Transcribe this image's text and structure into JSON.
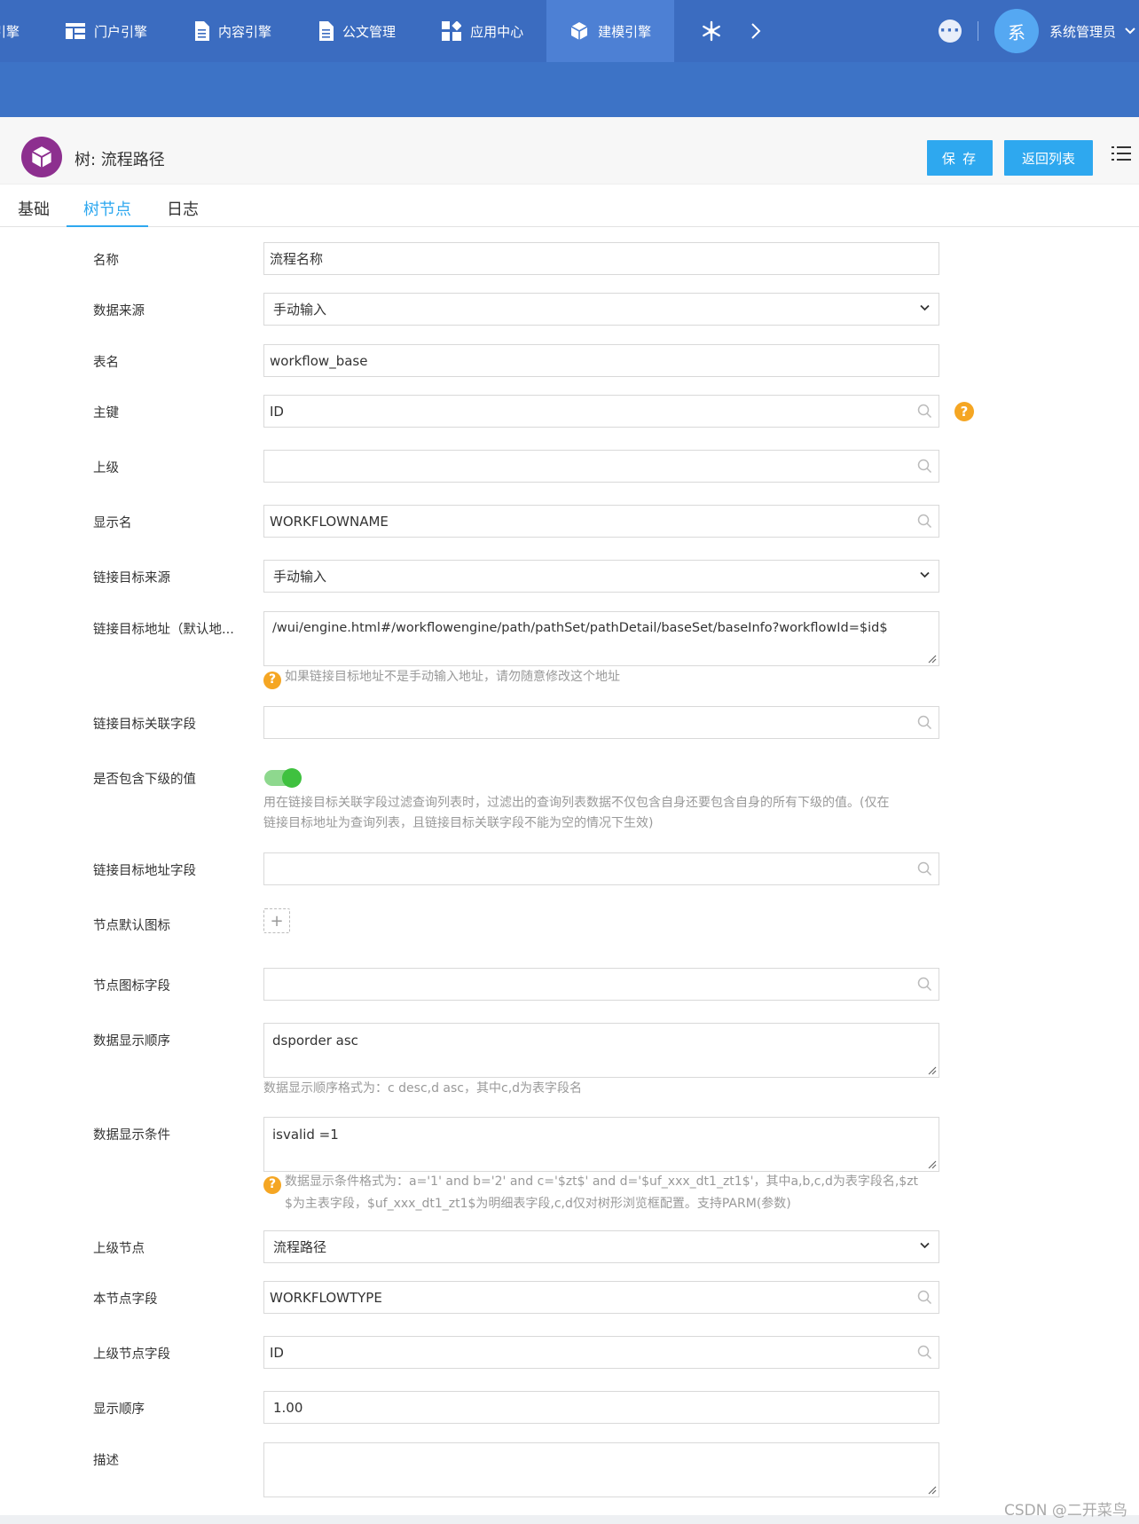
{
  "topnav": {
    "items": [
      {
        "label": "引擎",
        "icon": "none"
      },
      {
        "label": "门户引擎",
        "icon": "portal-layout-icon"
      },
      {
        "label": "内容引擎",
        "icon": "document-icon"
      },
      {
        "label": "公文管理",
        "icon": "document-icon"
      },
      {
        "label": "应用中心",
        "icon": "apps-grid-icon"
      },
      {
        "label": "建模引擎",
        "icon": "cube-icon"
      }
    ],
    "active_index": 5,
    "user_avatar_text": "系",
    "user_name": "系统管理员"
  },
  "header": {
    "title": "树: 流程路径",
    "save_label": "保 存",
    "return_label": "返回列表"
  },
  "tabs": [
    "基础",
    "树节点",
    "日志"
  ],
  "active_tab": 1,
  "form": {
    "name": {
      "label": "名称",
      "value": "流程名称"
    },
    "data_source": {
      "label": "数据来源",
      "value": "手动输入"
    },
    "table_name": {
      "label": "表名",
      "value": "workflow_base"
    },
    "primary_key": {
      "label": "主键",
      "value": "ID"
    },
    "parent": {
      "label": "上级",
      "value": ""
    },
    "display_name": {
      "label": "显示名",
      "value": "WORKFLOWNAME"
    },
    "link_source": {
      "label": "链接目标来源",
      "value": "手动输入"
    },
    "link_url": {
      "label": "链接目标地址（默认地...",
      "value": "/wui/engine.html#/workflowengine/path/pathSet/pathDetail/baseSet/baseInfo?workflowId=$id$",
      "hint": "如果链接目标地址不是手动输入地址，请勿随意修改这个地址"
    },
    "link_field": {
      "label": "链接目标关联字段",
      "value": ""
    },
    "include_children": {
      "label": "是否包含下级的值",
      "enabled": true,
      "hint_line1": "用在链接目标关联字段过滤查询列表时，过滤出的查询列表数据不仅包含自身还要包含自身的所有下级的值。(仅在",
      "hint_line2": "链接目标地址为查询列表，且链接目标关联字段不能为空的情况下生效)"
    },
    "link_url_field": {
      "label": "链接目标地址字段",
      "value": ""
    },
    "node_default_icon": {
      "label": "节点默认图标",
      "upload_glyph": "+"
    },
    "node_icon_field": {
      "label": "节点图标字段",
      "value": ""
    },
    "order": {
      "label": "数据显示顺序",
      "value": "dsporder asc",
      "hint": "数据显示顺序格式为：c desc,d asc，其中c,d为表字段名"
    },
    "condition": {
      "label": "数据显示条件",
      "value": "isvalid =1",
      "hint_line1": "数据显示条件格式为：a='1' and b='2' and c='$zt$' and d='$uf_xxx_dt1_zt1$'，其中a,b,c,d为表字段名,$zt",
      "hint_line2": "$为主表字段，$uf_xxx_dt1_zt1$为明细表字段,c,d仅对树形浏览框配置。支持PARM(参数)"
    },
    "parent_node": {
      "label": "上级节点",
      "value": "流程路径"
    },
    "node_field": {
      "label": "本节点字段",
      "value": "WORKFLOWTYPE"
    },
    "parent_node_field": {
      "label": "上级节点字段",
      "value": "ID"
    },
    "display_order": {
      "label": "显示顺序",
      "value": "1.00"
    },
    "description": {
      "label": "描述",
      "value": ""
    }
  },
  "watermark": "CSDN @二开菜鸟",
  "colors": {
    "topbar": "#3b6cc0",
    "accent": "#2ea8ef",
    "logo": "#8d2f8f",
    "warning": "#f5a623",
    "toggle": "#3fc13f"
  }
}
